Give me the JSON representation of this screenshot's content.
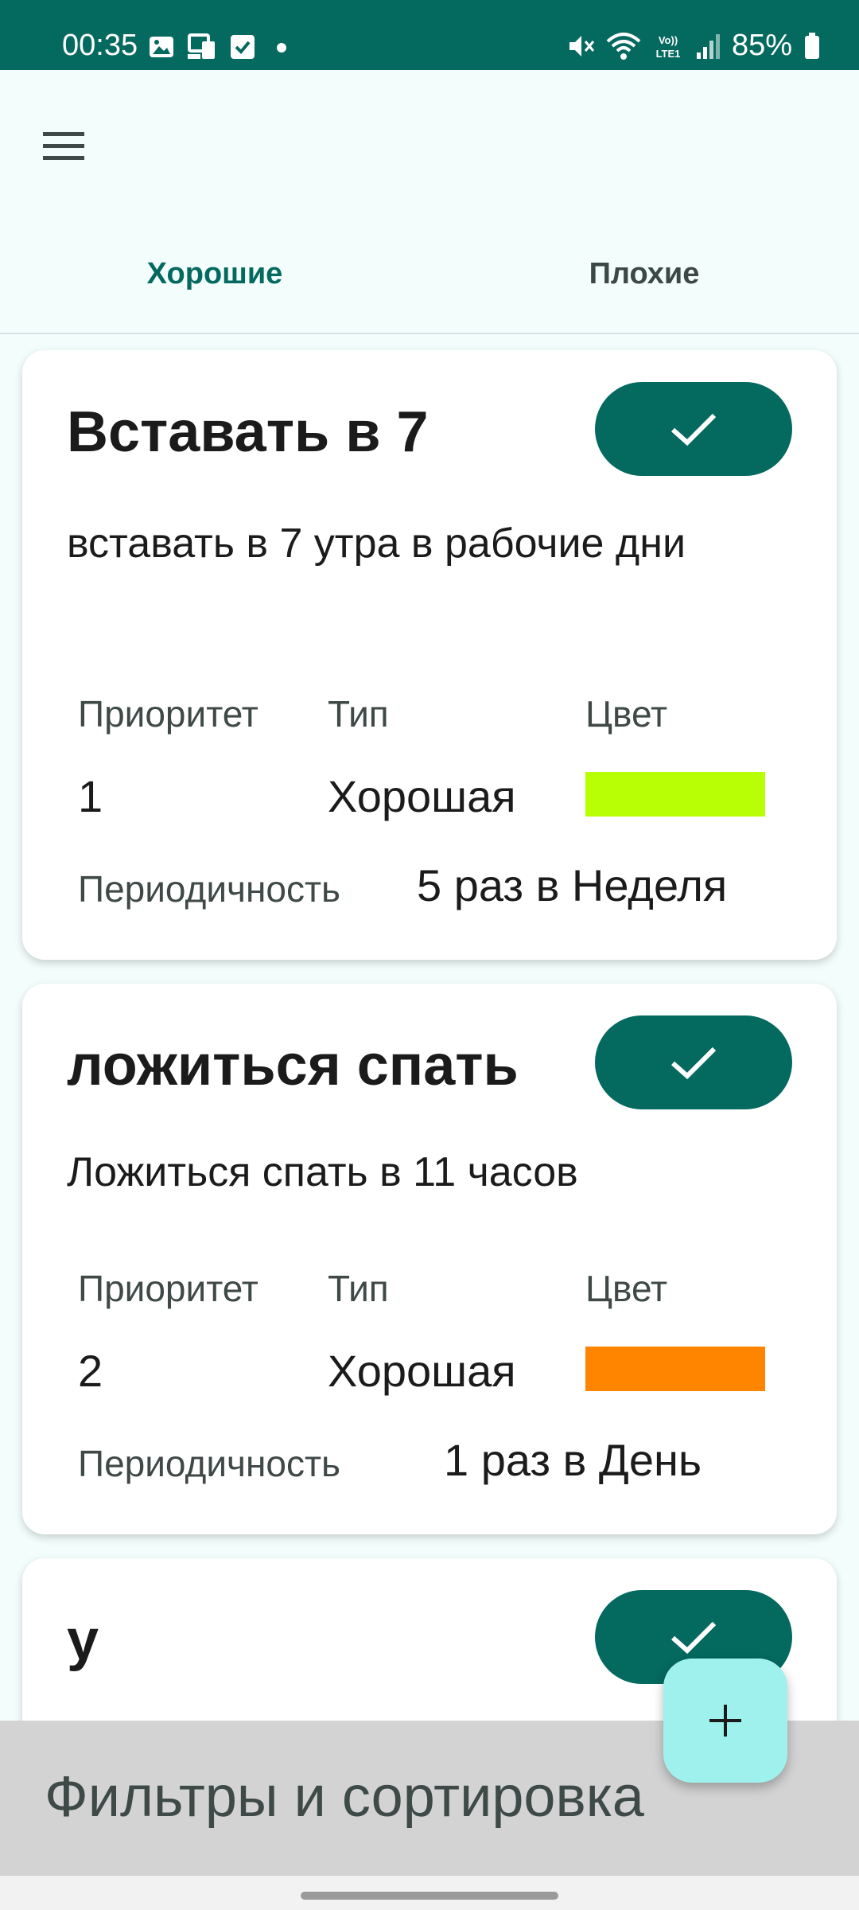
{
  "status_bar": {
    "time": "00:35",
    "battery": "85%",
    "icons": [
      "image-icon",
      "cast-icon",
      "check-box-icon",
      "dot-icon",
      "mute-icon",
      "wifi-icon",
      "volte-icon",
      "signal-icon",
      "battery-icon"
    ]
  },
  "tabs": [
    {
      "label": "Хорошие",
      "selected": true
    },
    {
      "label": "Плохие",
      "selected": false
    }
  ],
  "labels": {
    "priority": "Приоритет",
    "type": "Тип",
    "color": "Цвет",
    "periodicity": "Периодичность"
  },
  "habits": [
    {
      "title": "Вставать в 7",
      "description": "вставать в 7 утра в рабочие дни",
      "priority": "1",
      "type": "Хорошая",
      "color": "#b8ff05",
      "periodicity": "5 раз в Неделя"
    },
    {
      "title": "ложиться спать",
      "description": "Ложиться спать в 11 часов",
      "priority": "2",
      "type": "Хорошая",
      "color": "#ff8500",
      "periodicity": "1 раз в День"
    },
    {
      "title": "у"
    }
  ],
  "bottom_sheet": {
    "title": "Фильтры и сортировка"
  },
  "colors": {
    "primary": "#04695f",
    "fab": "#9ef1ec",
    "background": "#f2fdfc"
  }
}
